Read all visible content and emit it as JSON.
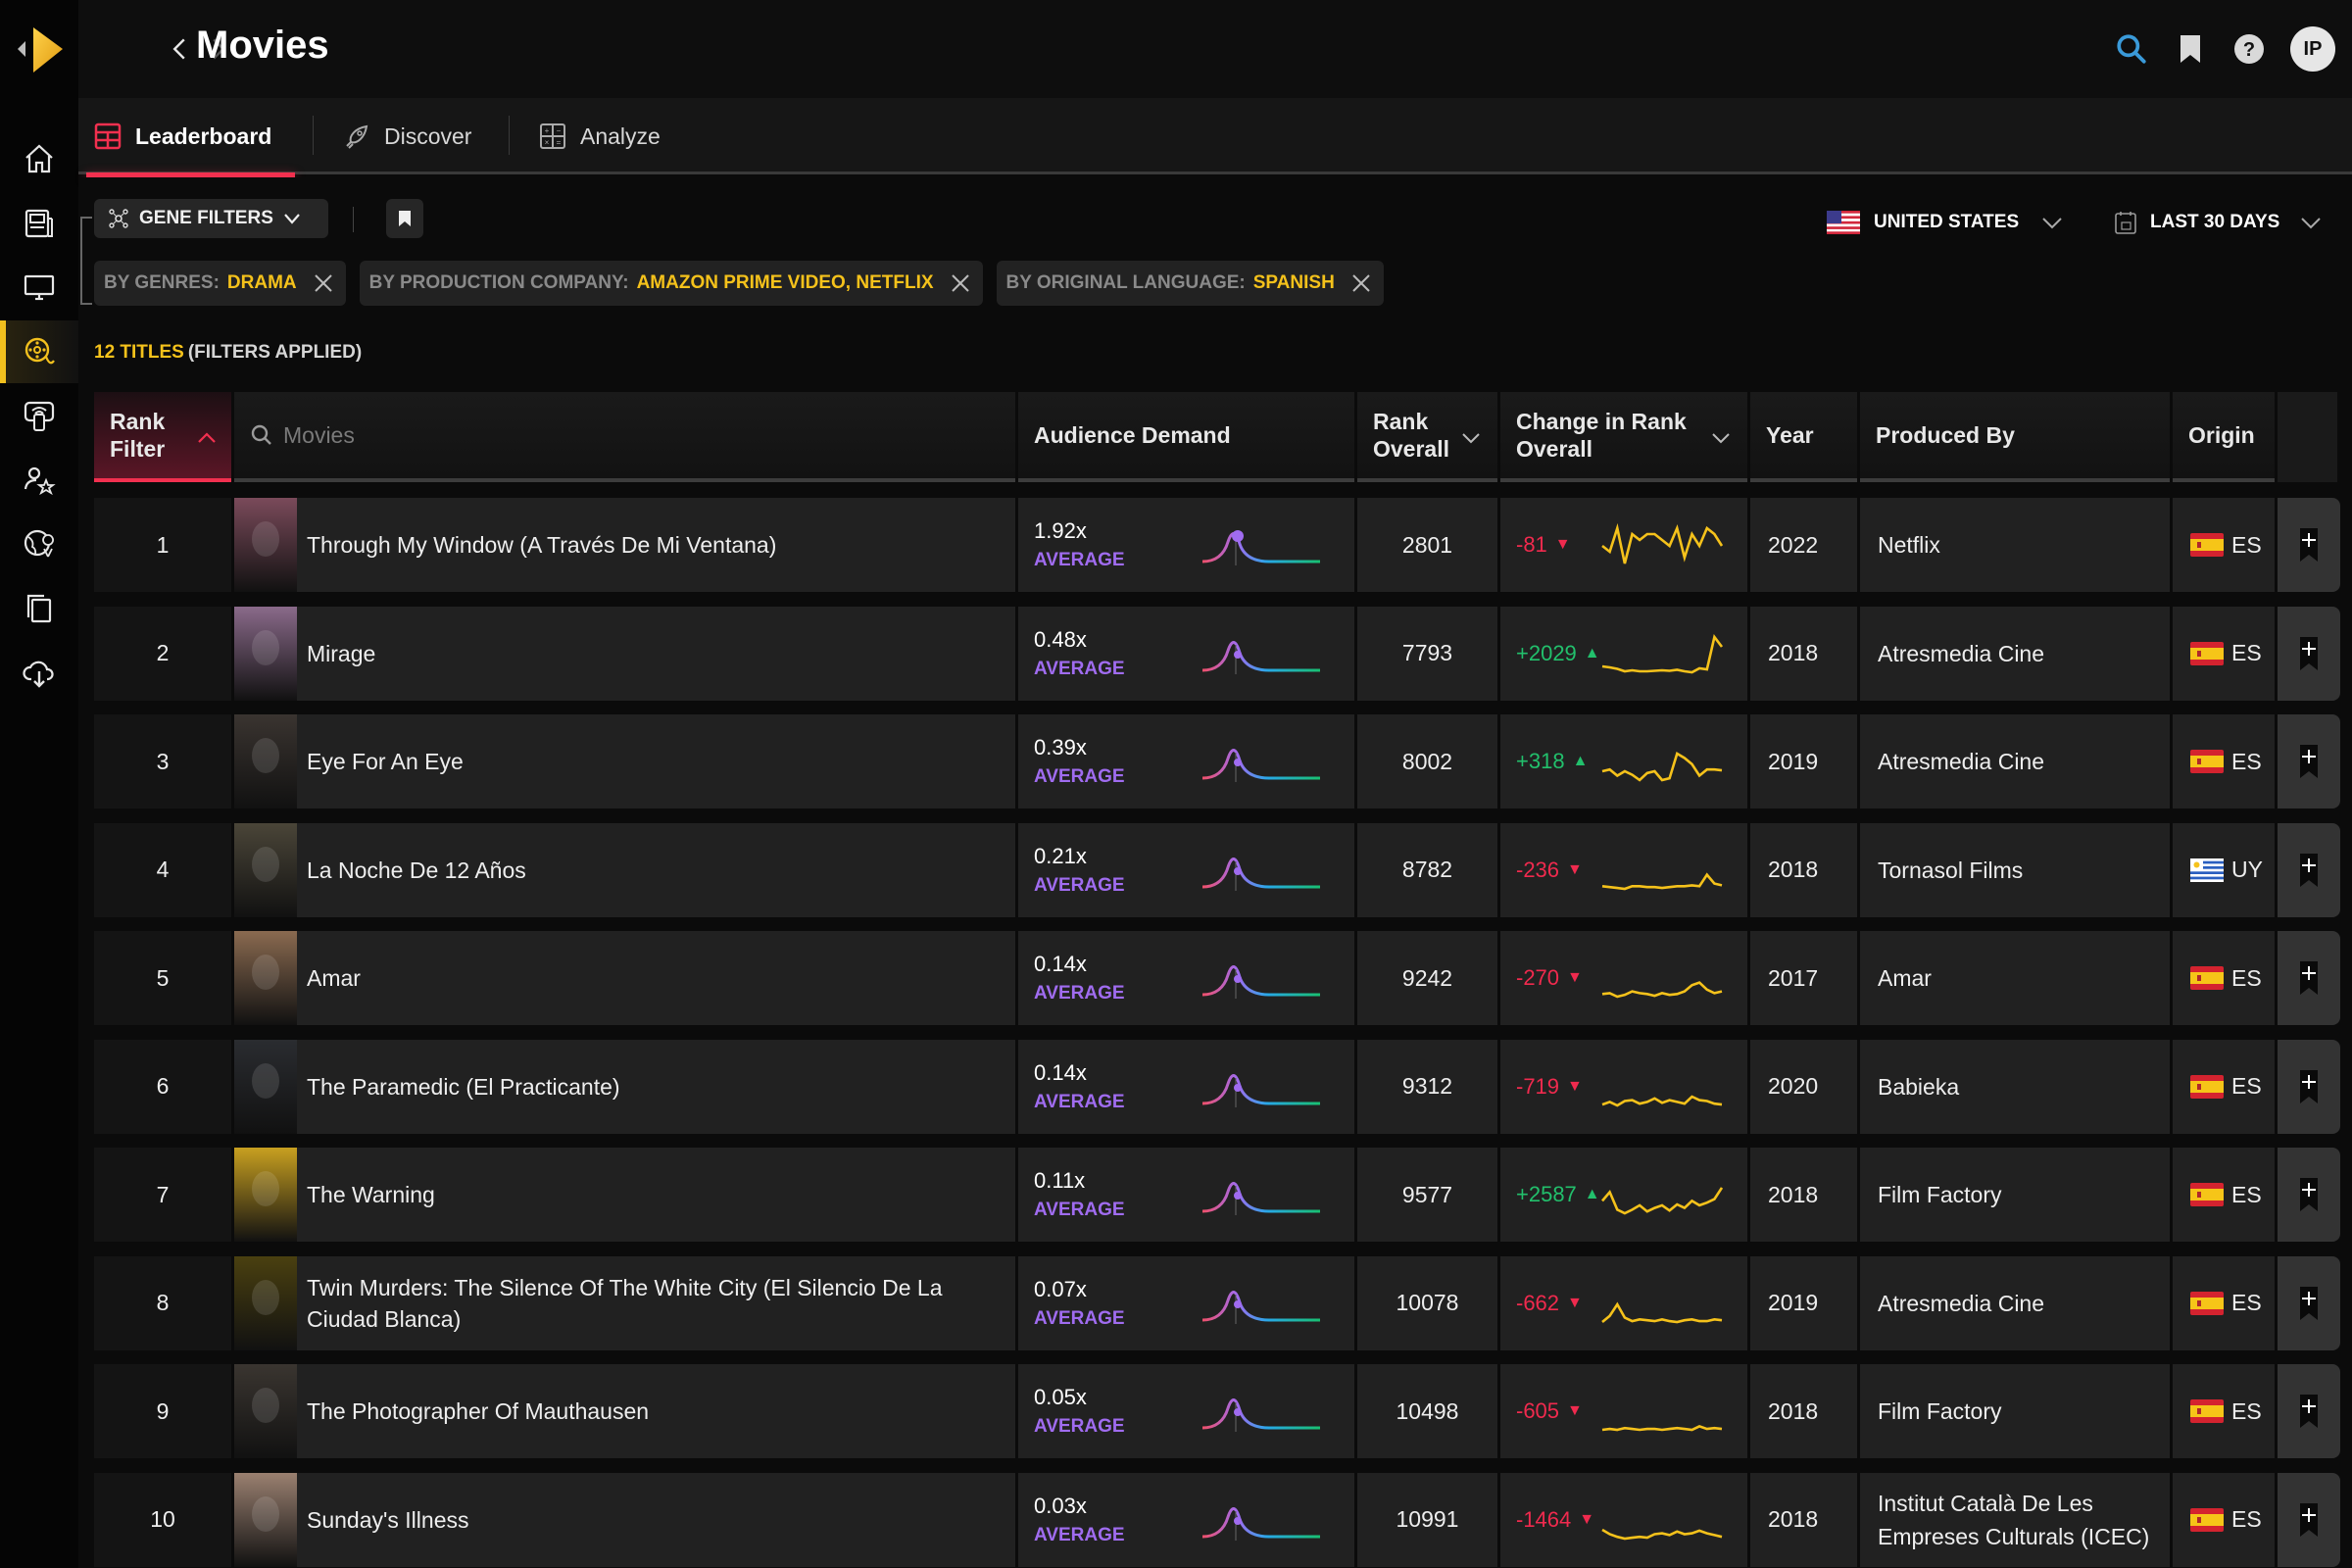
{
  "header": {
    "title": "Movies",
    "avatar_initials": "IP",
    "icons": [
      "search-icon",
      "bookmark-icon",
      "help-icon"
    ]
  },
  "sidebar": {
    "items": [
      {
        "name": "home",
        "active": false
      },
      {
        "name": "news",
        "active": false
      },
      {
        "name": "tv",
        "active": false
      },
      {
        "name": "movies",
        "active": true
      },
      {
        "name": "streaming",
        "active": false
      },
      {
        "name": "talent",
        "active": false
      },
      {
        "name": "global",
        "active": false
      },
      {
        "name": "copies",
        "active": false
      },
      {
        "name": "download",
        "active": false
      }
    ]
  },
  "tabs": [
    {
      "label": "Leaderboard",
      "active": true
    },
    {
      "label": "Discover",
      "active": false
    },
    {
      "label": "Analyze",
      "active": false
    }
  ],
  "toolbar": {
    "gene_filters_label": "GENE FILTERS",
    "country_label": "UNITED STATES",
    "date_label": "LAST 30 DAYS"
  },
  "chips": [
    {
      "key": "BY GENRES:",
      "value": "DRAMA"
    },
    {
      "key": "BY PRODUCTION COMPANY:",
      "value": "AMAZON PRIME VIDEO, NETFLIX"
    },
    {
      "key": "BY ORIGINAL LANGUAGE:",
      "value": "SPANISH"
    }
  ],
  "summary": {
    "count": "12 TITLES",
    "note": "(FILTERS APPLIED)"
  },
  "table": {
    "headers": {
      "rank_filter": "Rank\nFilter",
      "search_placeholder": "Movies",
      "demand": "Audience Demand",
      "rank_overall": "Rank\nOverall",
      "change": "Change in Rank\nOverall",
      "year": "Year",
      "produced_by": "Produced By",
      "origin": "Origin"
    },
    "rows": [
      {
        "rank": "1",
        "title": "Through My Window (A Través De Mi Ventana)",
        "demand": "1.92x",
        "demand_label": "AVERAGE",
        "rank_overall": "2801",
        "change": "-81",
        "dir": "down",
        "year": "2022",
        "producer": "Netflix",
        "origin": "ES",
        "poster_color": "#7a4a5a",
        "spark": [
          6,
          5,
          9,
          3,
          8,
          7,
          8,
          8,
          7,
          6,
          9,
          4,
          8,
          6,
          9,
          8,
          6
        ]
      },
      {
        "rank": "2",
        "title": "Mirage",
        "demand": "0.48x",
        "demand_label": "AVERAGE",
        "rank_overall": "7793",
        "change": "+2029",
        "dir": "up",
        "year": "2018",
        "producer": "Atresmedia Cine",
        "origin": "ES",
        "poster_color": "#8a6a8a",
        "spark": [
          3,
          2.8,
          2.5,
          2,
          2.2,
          2,
          2,
          2.1,
          2.2,
          2.1,
          2.3,
          2,
          1.8,
          2.6,
          2.4,
          9,
          7
        ]
      },
      {
        "rank": "3",
        "title": "Eye For An Eye",
        "demand": "0.39x",
        "demand_label": "AVERAGE",
        "rank_overall": "8002",
        "change": "+318",
        "dir": "up",
        "year": "2019",
        "producer": "Atresmedia Cine",
        "origin": "ES",
        "poster_color": "#3a3430",
        "spark": [
          3,
          3.2,
          2.5,
          3,
          2.6,
          2,
          2.8,
          3,
          2,
          2.2,
          5,
          4.5,
          3.8,
          2.5,
          3.2,
          3.2,
          3.1
        ]
      },
      {
        "rank": "4",
        "title": "La Noche De 12 Años",
        "demand": "0.21x",
        "demand_label": "AVERAGE",
        "rank_overall": "8782",
        "change": "-236",
        "dir": "down",
        "year": "2018",
        "producer": "Tornasol Films",
        "origin": "UY",
        "poster_color": "#4a4538",
        "spark": [
          2.5,
          2.4,
          2.3,
          2.2,
          2.5,
          2.5,
          2.4,
          2.4,
          2.3,
          2.4,
          2.5,
          2.5,
          2.6,
          2.5,
          3.8,
          2.8,
          2.6
        ]
      },
      {
        "rank": "5",
        "title": "Amar",
        "demand": "0.14x",
        "demand_label": "AVERAGE",
        "rank_overall": "9242",
        "change": "-270",
        "dir": "down",
        "year": "2017",
        "producer": "Amar",
        "origin": "ES",
        "poster_color": "#8a6a50",
        "spark": [
          2.5,
          2.6,
          2.2,
          2.4,
          2.8,
          2.6,
          2.5,
          2.3,
          2.6,
          2.4,
          2.5,
          2.8,
          3.5,
          3.8,
          3,
          2.6,
          2.8
        ]
      },
      {
        "rank": "6",
        "title": "The Paramedic (El Practicante)",
        "demand": "0.14x",
        "demand_label": "AVERAGE",
        "rank_overall": "9312",
        "change": "-719",
        "dir": "down",
        "year": "2020",
        "producer": "Babieka",
        "origin": "ES",
        "poster_color": "#2a2c30",
        "spark": [
          2.5,
          2.8,
          2.4,
          2.9,
          3,
          2.6,
          2.8,
          3.2,
          2.7,
          3,
          2.8,
          2.6,
          3.4,
          3,
          2.9,
          2.6,
          2.5
        ]
      },
      {
        "rank": "7",
        "title": "The Warning",
        "demand": "0.11x",
        "demand_label": "AVERAGE",
        "rank_overall": "9577",
        "change": "+2587",
        "dir": "up",
        "year": "2018",
        "producer": "Film Factory",
        "origin": "ES",
        "poster_color": "#c8a020",
        "spark": [
          4,
          5,
          3,
          2.6,
          3,
          3.5,
          2.8,
          3.2,
          3.5,
          2.9,
          3.6,
          3.2,
          4,
          3.5,
          3.8,
          4.2,
          5.5
        ]
      },
      {
        "rank": "8",
        "title": "Twin Murders: The Silence Of The White City (El Silencio De La Ciudad Blanca)",
        "demand": "0.07x",
        "demand_label": "AVERAGE",
        "rank_overall": "10078",
        "change": "-662",
        "dir": "down",
        "year": "2019",
        "producer": "Atresmedia Cine",
        "origin": "ES",
        "poster_color": "#4a4010",
        "spark": [
          2.5,
          3.2,
          4.5,
          3,
          2.6,
          2.8,
          2.7,
          2.6,
          2.8,
          2.6,
          2.5,
          2.7,
          2.8,
          2.6,
          2.6,
          2.8,
          2.7
        ]
      },
      {
        "rank": "9",
        "title": "The Photographer Of Mauthausen",
        "demand": "0.05x",
        "demand_label": "AVERAGE",
        "rank_overall": "10498",
        "change": "-605",
        "dir": "down",
        "year": "2018",
        "producer": "Film Factory",
        "origin": "ES",
        "poster_color": "#3a3530",
        "spark": [
          2.4,
          2.5,
          2.4,
          2.6,
          2.5,
          2.4,
          2.5,
          2.5,
          2.4,
          2.5,
          2.6,
          2.5,
          2.4,
          2.8,
          2.5,
          2.6,
          2.5
        ]
      },
      {
        "rank": "10",
        "title": "Sunday's Illness",
        "demand": "0.03x",
        "demand_label": "AVERAGE",
        "rank_overall": "10991",
        "change": "-1464",
        "dir": "down",
        "year": "2018",
        "producer": "Institut Català De Les Empreses Culturals (ICEC)",
        "origin": "ES",
        "poster_color": "#9a8070",
        "spark": [
          3,
          2.5,
          2.2,
          2,
          2.1,
          2.2,
          2.1,
          2.5,
          2.6,
          2.4,
          2.8,
          2.5,
          2.6,
          2.9,
          2.6,
          2.4,
          2.2
        ]
      }
    ]
  },
  "colors": {
    "accent_red": "#f2304f",
    "accent_yellow": "#f5c21b",
    "positive": "#22c06c",
    "negative": "#f02a4e",
    "demand_label": "#a06cf0",
    "sparkline": "#f5c21b"
  }
}
